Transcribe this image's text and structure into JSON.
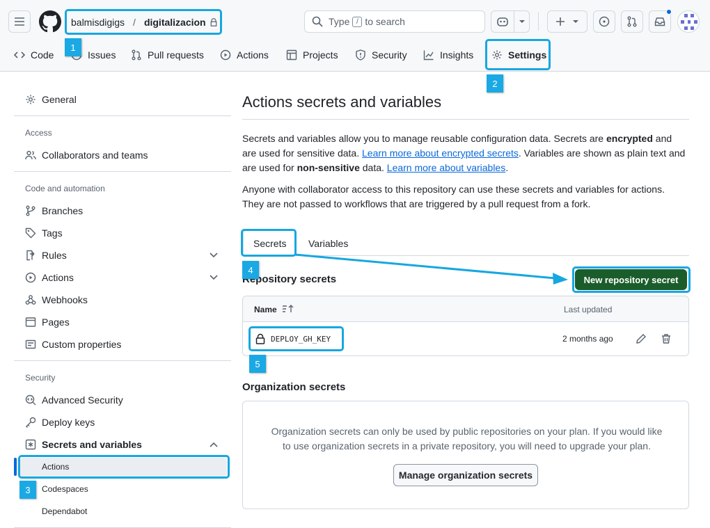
{
  "header": {
    "owner": "balmisdigigs",
    "separator": "/",
    "repo": "digitalizacion",
    "search_prefix": "Type",
    "search_key": "/",
    "search_suffix": "to search"
  },
  "repo_nav": [
    {
      "label": "Code",
      "icon": "code-icon"
    },
    {
      "label": "Issues",
      "icon": "issue-opened-icon"
    },
    {
      "label": "Pull requests",
      "icon": "git-pull-request-icon"
    },
    {
      "label": "Actions",
      "icon": "play-icon"
    },
    {
      "label": "Projects",
      "icon": "table-icon"
    },
    {
      "label": "Security",
      "icon": "shield-icon"
    },
    {
      "label": "Insights",
      "icon": "graph-icon"
    },
    {
      "label": "Settings",
      "icon": "gear-icon"
    }
  ],
  "callouts": [
    "1",
    "2",
    "3",
    "4",
    "5"
  ],
  "sidebar": {
    "general": "General",
    "access_heading": "Access",
    "collaborators": "Collaborators and teams",
    "code_heading": "Code and automation",
    "branches": "Branches",
    "tags": "Tags",
    "rules": "Rules",
    "actions": "Actions",
    "webhooks": "Webhooks",
    "pages": "Pages",
    "custom_properties": "Custom properties",
    "security_heading": "Security",
    "advanced_security": "Advanced Security",
    "deploy_keys": "Deploy keys",
    "secrets_and_variables": "Secrets and variables",
    "sub_actions": "Actions",
    "sub_codespaces": "Codespaces",
    "sub_dependabot": "Dependabot"
  },
  "main": {
    "title": "Actions secrets and variables",
    "p1_a": "Secrets and variables allow you to manage reusable configuration data. Secrets are ",
    "p1_b": "encrypted",
    "p1_c": " and are used for sensitive data. ",
    "p1_link1": "Learn more about encrypted secrets",
    "p1_d": ". Variables are shown as plain text and are used for ",
    "p1_e": "non-sensitive",
    "p1_f": " data. ",
    "p1_link2": "Learn more about variables",
    "p1_g": ".",
    "p2": "Anyone with collaborator access to this repository can use these secrets and variables for actions. They are not passed to workflows that are triggered by a pull request from a fork.",
    "tab_secrets": "Secrets",
    "tab_variables": "Variables",
    "repo_secrets_heading": "Repository secrets",
    "new_secret_button": "New repository secret",
    "col_name": "Name",
    "col_updated": "Last updated",
    "secrets": [
      {
        "name": "DEPLOY_GH_KEY",
        "updated": "2 months ago"
      }
    ],
    "org_secrets_heading": "Organization secrets",
    "org_text": "Organization secrets can only be used by public repositories on your plan. If you would like to use organization secrets in a private repository, you will need to upgrade your plan.",
    "manage_org_button": "Manage organization secrets"
  },
  "colors": {
    "callout": "#17a7e0",
    "primary_button": "#1a5d2a",
    "link": "#0969da"
  }
}
